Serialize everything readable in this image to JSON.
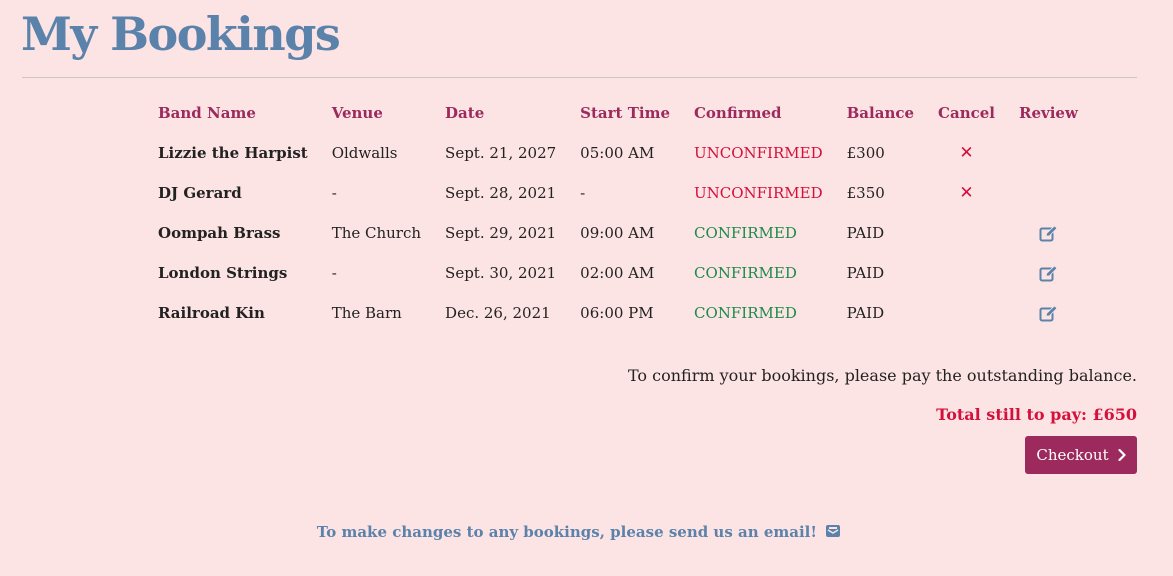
{
  "page": {
    "title": "My Bookings"
  },
  "table": {
    "headers": {
      "band_name": "Band Name",
      "venue": "Venue",
      "date": "Date",
      "start_time": "Start Time",
      "confirmed": "Confirmed",
      "balance": "Balance",
      "cancel": "Cancel",
      "review": "Review"
    },
    "rows": [
      {
        "band_name": "Lizzie the Harpist",
        "venue": "Oldwalls",
        "date": "Sept. 21, 2027",
        "start_time": "05:00 AM",
        "confirmed": "UNCONFIRMED",
        "balance": "£300",
        "cancel_icon": "cancel-x-icon",
        "review_icon": ""
      },
      {
        "band_name": "DJ Gerard",
        "venue": "-",
        "date": "Sept. 28, 2021",
        "start_time": "-",
        "confirmed": "UNCONFIRMED",
        "balance": "£350",
        "cancel_icon": "cancel-x-icon",
        "review_icon": ""
      },
      {
        "band_name": "Oompah Brass",
        "venue": "The Church",
        "date": "Sept. 29, 2021",
        "start_time": "09:00 AM",
        "confirmed": "CONFIRMED",
        "balance": "PAID",
        "cancel_icon": "",
        "review_icon": "edit-icon"
      },
      {
        "band_name": "London Strings",
        "venue": "-",
        "date": "Sept. 30, 2021",
        "start_time": "02:00 AM",
        "confirmed": "CONFIRMED",
        "balance": "PAID",
        "cancel_icon": "",
        "review_icon": "edit-icon"
      },
      {
        "band_name": "Railroad Kin",
        "venue": "The Barn",
        "date": "Dec. 26, 2021",
        "start_time": "06:00 PM",
        "confirmed": "CONFIRMED",
        "balance": "PAID",
        "cancel_icon": "",
        "review_icon": "edit-icon"
      }
    ]
  },
  "payment": {
    "note": "To confirm your bookings, please pay the outstanding balance.",
    "total_label": "Total still to pay: £650",
    "checkout_label": "Checkout",
    "checkout_icon": "chevron-right-icon"
  },
  "footer": {
    "note": "To make changes to any bookings, please send us an email!",
    "icon": "envelope-icon"
  },
  "colors": {
    "background": "#fde4e4",
    "title": "#5b82aa",
    "header": "#9c2a5c",
    "unconfirmed": "#d4103c",
    "confirmed": "#1c8a4c",
    "checkout_button": "#9c2a5c",
    "footer_text": "#5b82aa"
  }
}
